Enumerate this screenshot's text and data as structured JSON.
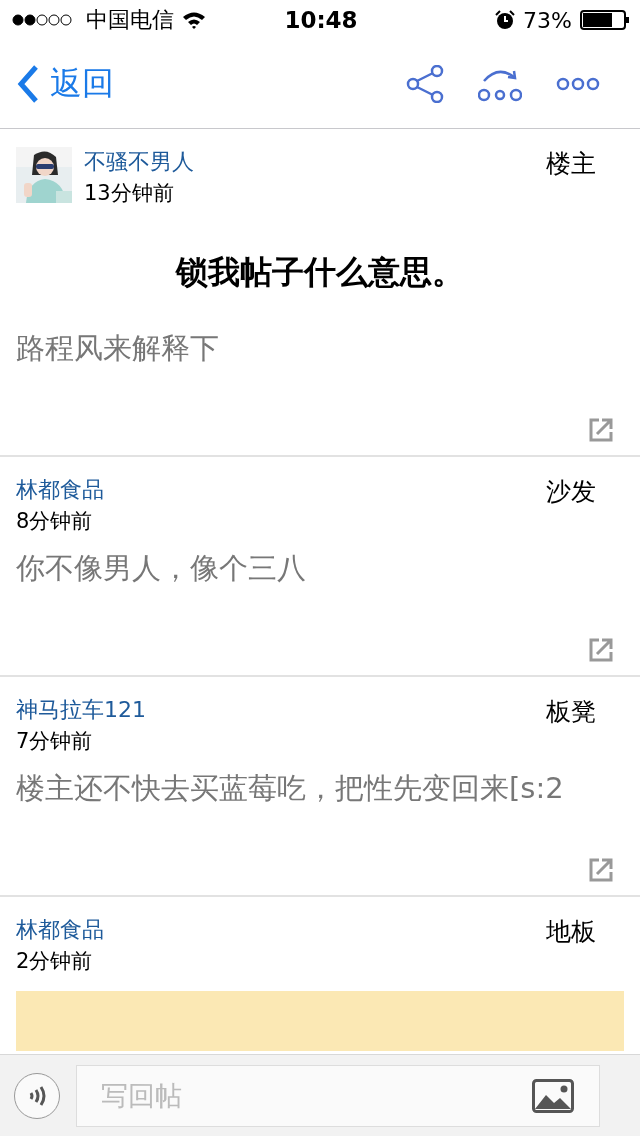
{
  "status_bar": {
    "carrier": "中国电信",
    "time": "10:48",
    "battery": "73%"
  },
  "nav": {
    "back": "返回"
  },
  "posts": [
    {
      "author": "不骚不男人",
      "time": "13分钟前",
      "floor": "楼主",
      "title": "锁我帖子什么意思。",
      "body": "路程风来解释下",
      "has_quote": false
    },
    {
      "author": "林都食品",
      "time": "8分钟前",
      "floor": "沙发",
      "body": "你不像男人，像个三八",
      "has_quote": false
    },
    {
      "author": "神马拉车121",
      "time": "7分钟前",
      "floor": "板凳",
      "body": "楼主还不快去买蓝莓吃，把性先变回来[s:2",
      "has_quote": false
    },
    {
      "author": "林都食品",
      "time": "2分钟前",
      "floor": "地板",
      "has_quote": true
    }
  ],
  "reply_bar": {
    "placeholder": "写回帖"
  }
}
